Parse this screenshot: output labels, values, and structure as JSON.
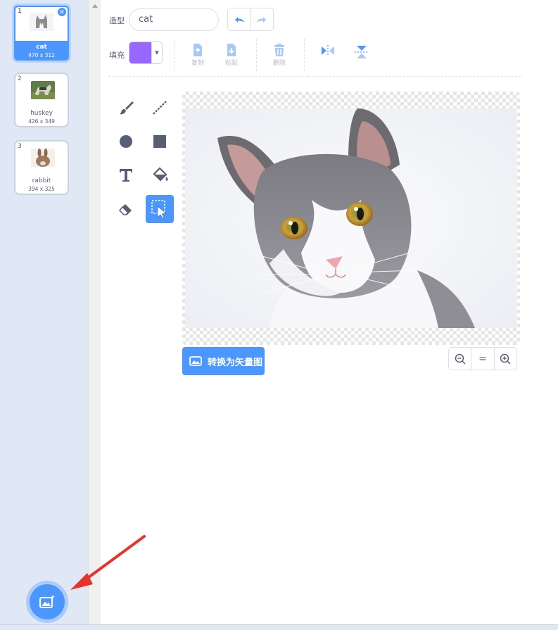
{
  "costumes": [
    {
      "index": "1",
      "name": "cat",
      "size": "470 x 312",
      "selected": true
    },
    {
      "index": "2",
      "name": "huskey",
      "size": "426 x 349",
      "selected": false
    },
    {
      "index": "3",
      "name": "rabbit",
      "size": "394 x 325",
      "selected": false
    }
  ],
  "editor": {
    "costume_label": "造型",
    "costume_name": "cat",
    "fill_label": "填充",
    "fill_color": "#9966ff",
    "copy_label": "复制",
    "paste_label": "粘贴",
    "delete_label": "删除",
    "convert_label": "转换为矢量图",
    "zoom_reset_label": "="
  },
  "colors": {
    "accent": "#4c97ff",
    "sidebar": "#dfe8f4",
    "disabled": "#b4bcc8"
  },
  "icons": {
    "undo": "undo-icon",
    "redo": "redo-icon",
    "flip_h": "flip-horizontal-icon",
    "flip_v": "flip-vertical-icon",
    "add_costume": "add-costume-icon"
  }
}
